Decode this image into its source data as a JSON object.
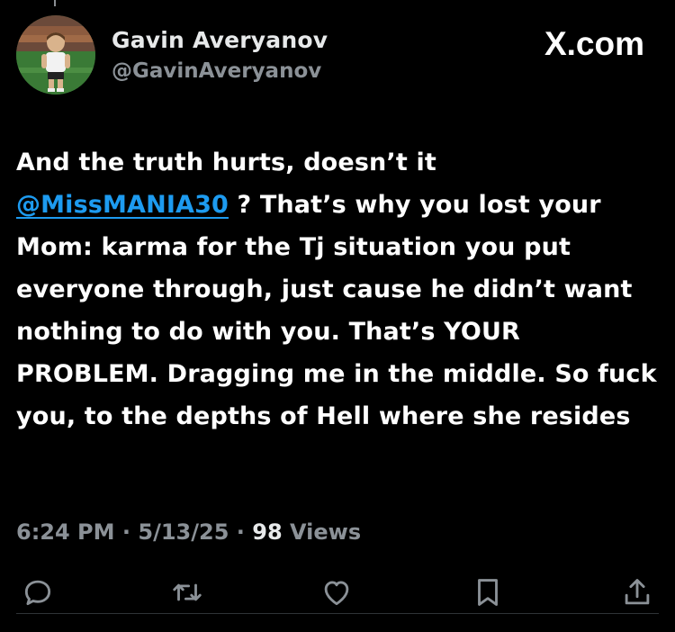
{
  "author": {
    "display_name": "Gavin Averyanov",
    "handle": "@GavinAveryanov"
  },
  "brand": "X.com",
  "tweet": {
    "pre_mention": "And the truth hurts, doesn’t it",
    "mention": "@MissMANIA30",
    "body": " ? That’s why you lost your Mom: karma for the Tj situation you put everyone through, just cause he didn’t want nothing to do with you. That’s YOUR PROBLEM. Dragging me in the middle. So fuck you, to the depths of Hell where she resides"
  },
  "meta": {
    "time": "6:24 PM",
    "date": "5/13/25",
    "views_count": "98",
    "views_label": "Views",
    "separator": "·"
  },
  "actions": [
    {
      "icon": "reply-icon"
    },
    {
      "icon": "retweet-icon"
    },
    {
      "icon": "like-icon"
    },
    {
      "icon": "bookmark-icon"
    },
    {
      "icon": "share-icon"
    }
  ],
  "colors": {
    "background": "#000000",
    "text": "#e7e9ea",
    "secondary": "#8b9197",
    "link": "#1d9bf0"
  }
}
